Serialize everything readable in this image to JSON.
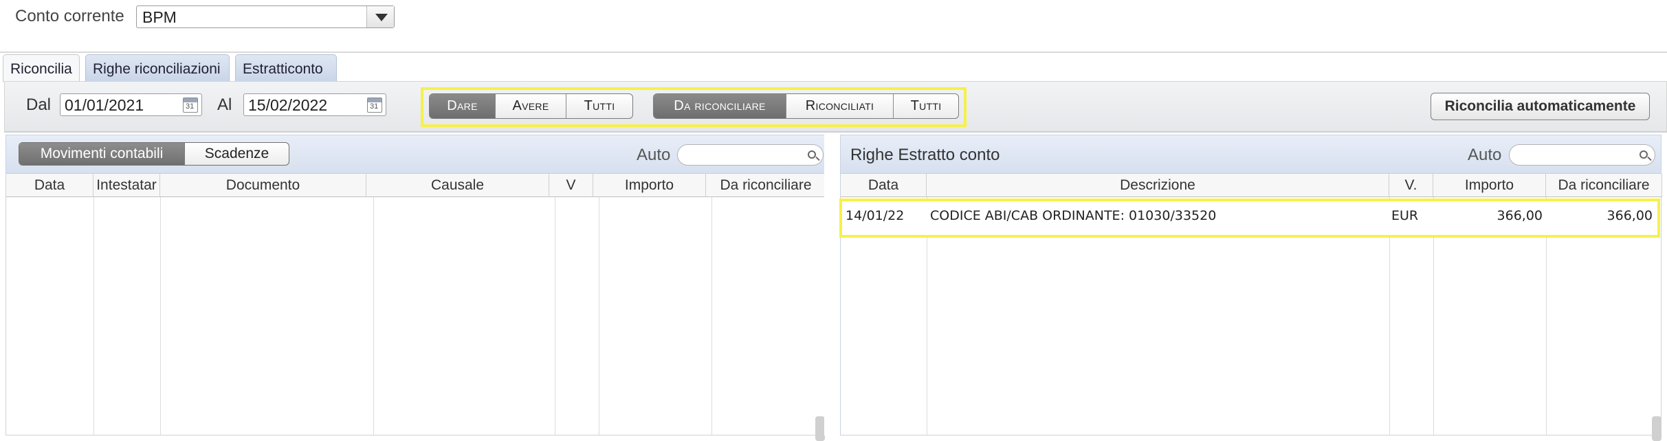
{
  "account": {
    "label": "Conto corrente",
    "selected": "BPM"
  },
  "tabs": [
    {
      "label": "Riconcilia",
      "active": true
    },
    {
      "label": "Righe riconciliazioni",
      "active": false
    },
    {
      "label": "Estratticonto",
      "active": false
    }
  ],
  "filters": {
    "from_label": "Dal",
    "from_value": "01/01/2021",
    "to_label": "Al",
    "to_value": "15/02/2022",
    "direction": [
      "Dare",
      "Avere",
      "Tutti"
    ],
    "direction_selected": "Dare",
    "status": [
      "Da riconciliare",
      "Riconciliati",
      "Tutti"
    ],
    "status_selected": "Da riconciliare",
    "auto_reconcile_button": "Riconcilia automaticamente"
  },
  "left_panel": {
    "subtabs": [
      "Movimenti contabili",
      "Scadenze"
    ],
    "subtab_selected": "Movimenti contabili",
    "auto_label": "Auto",
    "columns": [
      "Data",
      "Intestatar",
      "Documento",
      "Causale",
      "V",
      "Importo",
      "Da riconciliare"
    ],
    "rows": []
  },
  "right_panel": {
    "title": "Righe Estratto conto",
    "auto_label": "Auto",
    "columns": [
      "Data",
      "Descrizione",
      "V.",
      "Importo",
      "Da riconciliare"
    ],
    "rows": [
      {
        "data": "14/01/22",
        "descrizione": "CODICE ABI/CAB ORDINANTE: 01030/33520",
        "valuta": "EUR",
        "importo": "366,00",
        "da_riconciliare": "366,00"
      }
    ]
  },
  "colors": {
    "highlight": "#f5f14a",
    "selected_segment": "#7a7a7a",
    "panel_header": "#dbe3f1"
  }
}
